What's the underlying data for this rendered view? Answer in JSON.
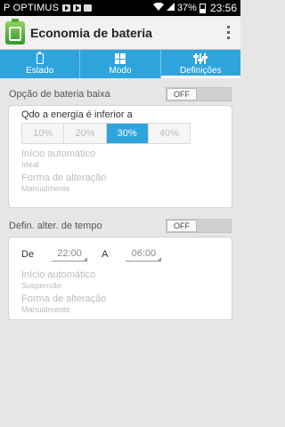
{
  "status_bar": {
    "carrier": "P OPTIMUS",
    "battery_percent": "37%",
    "time": "23:56"
  },
  "appbar": {
    "title": "Economia de bateria"
  },
  "tabs": [
    {
      "label": "Estado",
      "icon": "battery-icon",
      "active": false
    },
    {
      "label": "Modo",
      "icon": "mode-icon",
      "active": false
    },
    {
      "label": "Definições",
      "icon": "sliders-icon",
      "active": true
    }
  ],
  "low_battery": {
    "label": "Opção de bateria baixa",
    "toggle_value": "OFF",
    "threshold_label": "Qdo a energia é inferior a",
    "threshold_options": [
      "10%",
      "20%",
      "30%",
      "40%"
    ],
    "threshold_selected": "30%",
    "auto_start_title": "Início automático",
    "auto_start_value": "Ideal",
    "change_mode_title": "Forma de alteração",
    "change_mode_value": "Manualmente"
  },
  "time_change": {
    "label": "Defin. alter. de tempo",
    "toggle_value": "OFF",
    "from_label": "De",
    "from_value": "22:00",
    "to_label": "A",
    "to_value": "06:00",
    "auto_start_title": "Início automático",
    "auto_start_value": "Suspensão",
    "change_mode_title": "Forma de alteração",
    "change_mode_value": "Manualmente"
  },
  "colors": {
    "accent": "#2fa4dc"
  }
}
